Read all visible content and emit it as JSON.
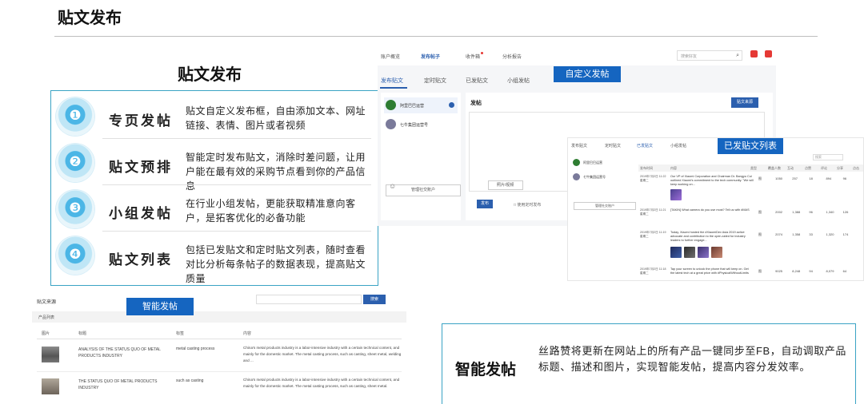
{
  "page_title": "贴文发布",
  "features": {
    "heading": "贴文发布",
    "items": [
      {
        "name": "专页发帖",
        "icon": "lightbulb-head-icon",
        "desc": "贴文自定义发布框，自由添加文本、网址链接、表情、图片或者视频"
      },
      {
        "name": "贴文预排",
        "icon": "people-schedule-icon",
        "desc": "智能定时发布贴文，消除时差问题，让用户能在最有效的采购节点看到你的产品信息"
      },
      {
        "name": "小组发帖",
        "icon": "globe-hands-icon",
        "desc": "在行业小组发帖，更能获取精准意向客户，是拓客优化的必备功能"
      },
      {
        "name": "贴文列表",
        "icon": "money-bag-icon",
        "desc": "包括已发贴文和定时贴文列表，随时查看对比分析每条帖子的数据表现，提高贴文质量"
      }
    ]
  },
  "publish_screen": {
    "nav": [
      "账户概览",
      "发布帖子",
      "收件箱",
      "分析报告"
    ],
    "active_nav": 1,
    "search_placeholder": "搜索好友",
    "tabs": [
      "发布贴文",
      "定时贴文",
      "已发贴文",
      "小组发帖"
    ],
    "active_tab": 0,
    "accounts": [
      "阿里巴巴运营",
      "七牛集团运营号"
    ],
    "manage_accounts": "管理社交账户",
    "post_label": "发帖",
    "custom_post_button": "贴文来源",
    "media_button": "照片/视频",
    "publish_button": "发布",
    "schedule_option": "□ 使用定时发布",
    "callout": "自定义发帖"
  },
  "list_screen": {
    "tabs": [
      "发布贴文",
      "定时贴文",
      "已发贴文",
      "小组发帖"
    ],
    "active_tab": 2,
    "accounts": [
      "阿里巴巴运营",
      "七牛集团运营号"
    ],
    "manage_accounts": "管理社交账户",
    "search_placeholder": "搜索",
    "columns": [
      "发布时间",
      "内容",
      "类型",
      "覆盖人数",
      "互动",
      "点赞",
      "评论",
      "分享",
      "点击",
      "评论"
    ],
    "rows": [
      {
        "date": "2019年7月2日 11:22 星期二",
        "text": "Our VP of Xiaomi Corporation and Chairman Dr. Bangyu Cui outlined Xiaomi's commitment to the tech community. \"We will keep working on...",
        "type": "图",
        "metrics": [
          "1050",
          "257",
          "18",
          "894",
          "96"
        ]
      },
      {
        "date": "2019年7月2日 11:21 星期二",
        "text": "[TAKIN] What camera do you use most? Tell us with #MAS",
        "type": "图",
        "metrics": [
          "2002",
          "1,388",
          "96",
          "1,340",
          "126"
        ]
      },
      {
        "date": "2019年7月2日 11:19 星期二",
        "text": "Today, Xiaomi hosted the #XiaomiDev Asia 2019 active advocate and contribution to the open-sided for industry leaders to further engage...",
        "type": "图",
        "metrics": [
          "2074",
          "1,358",
          "33",
          "1,320",
          "174"
        ]
      },
      {
        "date": "2019年7月2日 11:18 星期二",
        "text": "Tap your screen to unlock the phone that will keep on. Get the latest tech at a great price with #PhysicalWithoutLimits",
        "type": "图",
        "metrics": [
          "9025",
          "8,248",
          "94",
          "8,079",
          "64"
        ]
      }
    ],
    "callout": "已发贴文列表"
  },
  "product_screen": {
    "label": "贴文来源",
    "search_button": "搜索",
    "section": "产品列表",
    "columns": [
      "图片",
      "标题",
      "标签",
      "内容"
    ],
    "rows": [
      {
        "title": "ANALYSIS OF THE STATUS QUO OF METAL PRODUCTS INDUSTRY",
        "tag": "metal  casting process",
        "content": "China's metal products industry is a labor-intensive industry with a certain technical content, and mainly for the domestic market. The metal casting process, such as casting, sheet metal, welding and ..."
      },
      {
        "title": "THE STATUS QUO OF METAL PRODUCTS INDUSTRY",
        "tag": "such as casting",
        "content": "China's metal products industry is a labor-intensive industry with a certain technical content, and mainly for the domestic market. The metal casting process, such as casting, sheet metal."
      }
    ],
    "callout": "智能发帖"
  },
  "smart_post": {
    "title": "智能发帖",
    "desc": "丝路赞将更新在网站上的所有产品一键同步至FB，自动调取产品标题、描述和图片，实现智能发帖，提高内容分发效率。"
  },
  "colors": {
    "accent": "#1565c0",
    "border": "#3aa3c4",
    "brand_blue": "#2b5fae",
    "alert": "#e53935"
  }
}
